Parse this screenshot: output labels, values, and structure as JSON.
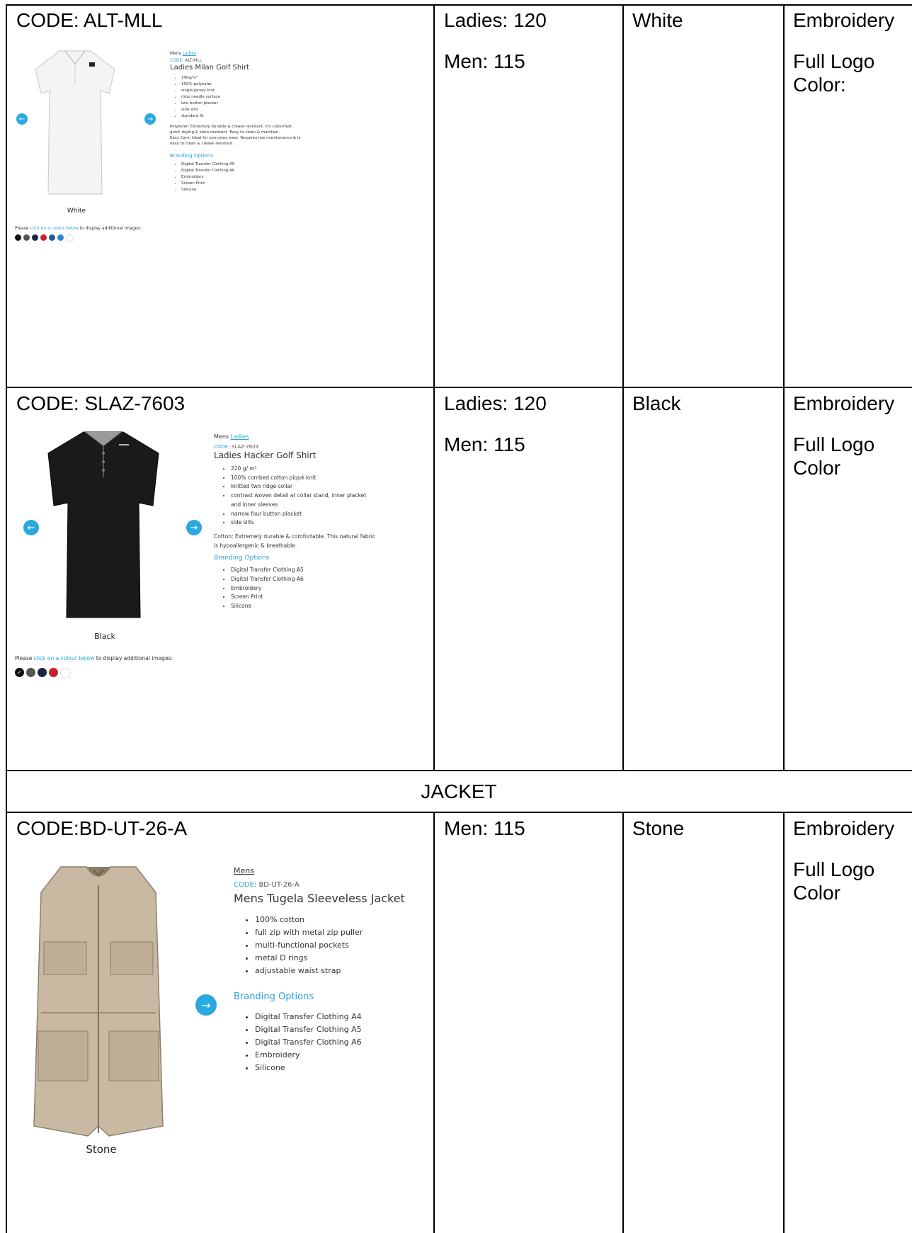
{
  "rows": [
    {
      "code": "CODE: ALT-MLL",
      "sizes": [
        "Ladies: 120",
        "Men: 115"
      ],
      "color": "White",
      "branding": [
        "Embroidery",
        "Full Logo Color:"
      ],
      "product": {
        "tabs": [
          "Mens",
          "Ladies"
        ],
        "code_key": "CODE:",
        "code_val": "ALT-MLL",
        "title": "Ladies Milan Golf Shirt",
        "features": [
          "190g/m²",
          "100% polyester",
          "single jersey knit",
          "drop needle surface",
          "two button placket",
          "side slits",
          "standard fit"
        ],
        "description": [
          "Polyester: Extremely durable & crease resistant. It's colourfast, quick drying & stain resistant. Easy to clean & maintain.",
          "Easy Care: Ideal for everyday wear. Requires low maintenance & is easy to clean & crease resistant."
        ],
        "branding_heading": "Branding Options",
        "branding_options": [
          "Digital Transfer Clothing A5",
          "Digital Transfer Clothing A6",
          "Embroidery",
          "Screen Print",
          "Silicone"
        ],
        "image_caption": "White",
        "prompt_pre": "Please ",
        "prompt_link": "click on a colour below",
        "prompt_post": " to display additional images:",
        "swatches": [
          "#111111",
          "#555555",
          "#1c2447",
          "#c8202e",
          "#1e5aa8",
          "#2f86cf",
          "#ffffff"
        ]
      }
    },
    {
      "code": "CODE: SLAZ-7603",
      "sizes": [
        "Ladies: 120",
        "Men: 115"
      ],
      "color": "Black",
      "branding": [
        "Embroidery",
        "Full Logo Color"
      ],
      "product": {
        "tabs": [
          "Mens",
          "Ladies"
        ],
        "code_key": "CODE:",
        "code_val": "SLAZ-7603",
        "title": "Ladies Hacker Golf Shirt",
        "features": [
          "220 g/ m²",
          "100% combed cotton piqué knit",
          "knitted two ridge collar",
          "contrast woven detail at collar stand, inner placket and inner sleeves",
          "narrow four button placket",
          "side slits"
        ],
        "description": [
          "Cotton: Extremely durable & comfortable. This natural fabric is hypoallergenic & breathable."
        ],
        "branding_heading": "Branding Options",
        "branding_options": [
          "Digital Transfer Clothing A5",
          "Digital Transfer Clothing A6",
          "Embroidery",
          "Screen Print",
          "Silicone"
        ],
        "image_caption": "Black",
        "prompt_pre": "Please ",
        "prompt_link": "click on a colour below",
        "prompt_post": " to display additional images:",
        "swatches": [
          "#111111",
          "#555555",
          "#1c2447",
          "#c8202e",
          "#ffffff"
        ]
      }
    },
    {
      "code": "CODE:BD-UT-26-A",
      "sizes": [
        "Men: 115"
      ],
      "color": "Stone",
      "branding": [
        "Embroidery",
        "Full Logo Color"
      ],
      "product": {
        "tabs": [
          "Mens"
        ],
        "code_key": "CODE:",
        "code_val": "BD-UT-26-A",
        "title": "Mens Tugela Sleeveless Jacket",
        "features": [
          "100% cotton",
          "full zip with metal zip puller",
          "multi-functional pockets",
          "metal D rings",
          "adjustable waist strap"
        ],
        "branding_heading": "Branding Options",
        "branding_options": [
          "Digital Transfer Clothing A4",
          "Digital Transfer Clothing A5",
          "Digital Transfer Clothing A6",
          "Embroidery",
          "Silicone"
        ],
        "image_caption": "Stone"
      }
    }
  ],
  "section_heading": "JACKET"
}
